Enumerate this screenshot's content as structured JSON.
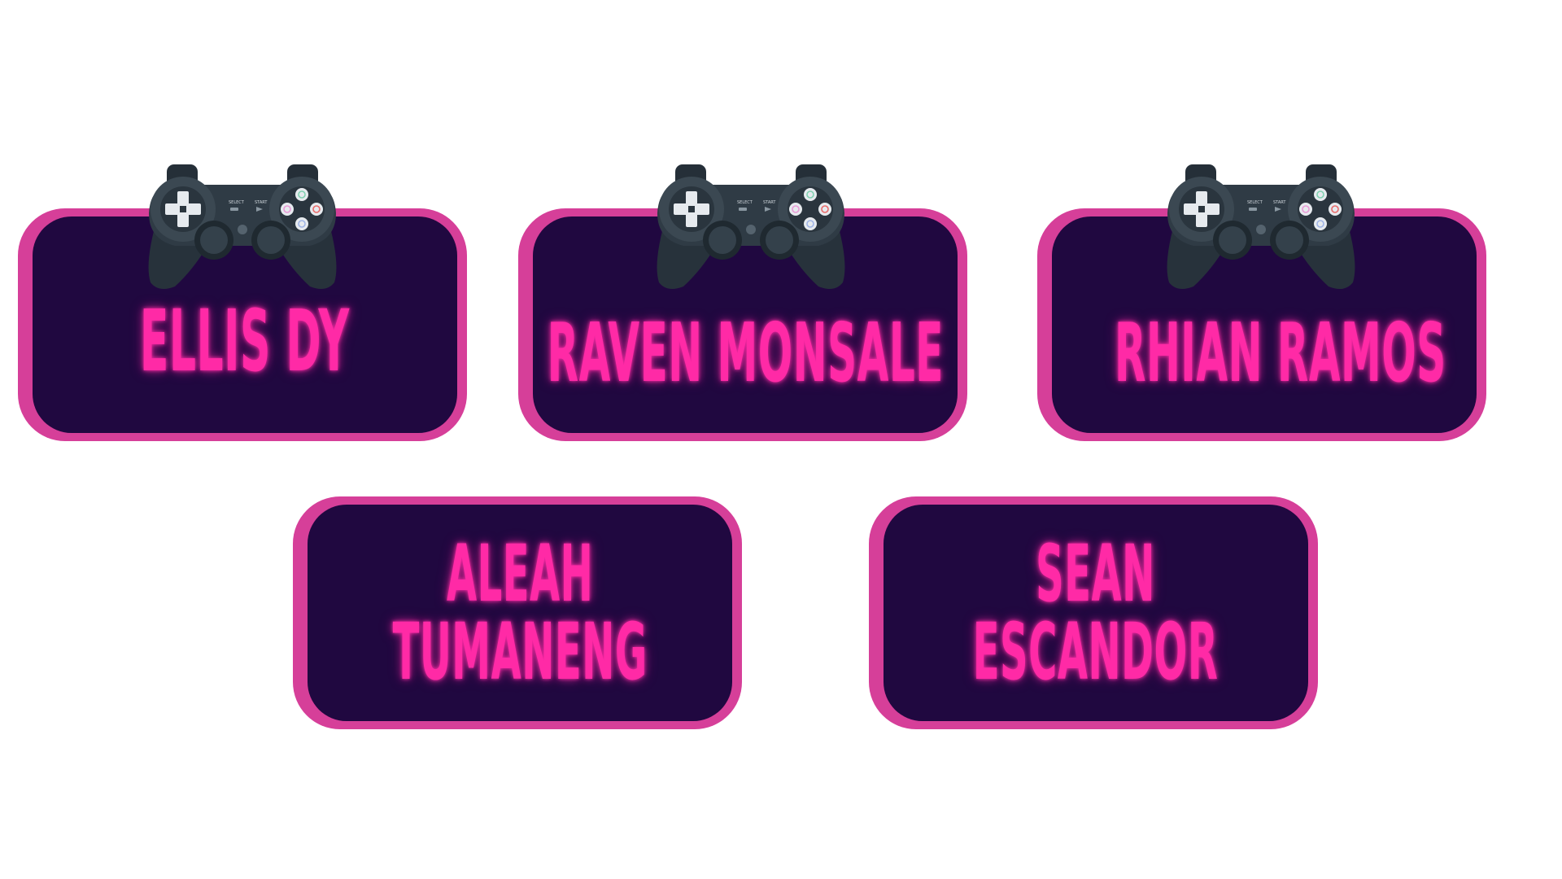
{
  "colors": {
    "background": "#ffffff",
    "card_border": "#d63f99",
    "card_fill": "#200840",
    "neon_text": "#ff2aa6",
    "controller_body": "#2f3b45"
  },
  "icons": {
    "controller": "gamepad-icon"
  },
  "cards": [
    {
      "name_lines": [
        "ELLIS DY"
      ]
    },
    {
      "name_lines": [
        "RAVEN MONSALE"
      ]
    },
    {
      "name_lines": [
        "RHIAN RAMOS"
      ]
    },
    {
      "name_lines": [
        "ALEAH",
        "TUMANENG"
      ]
    },
    {
      "name_lines": [
        "SEAN",
        "ESCANDOR"
      ]
    }
  ],
  "controller_labels": {
    "select": "SELECT",
    "start": "START"
  }
}
